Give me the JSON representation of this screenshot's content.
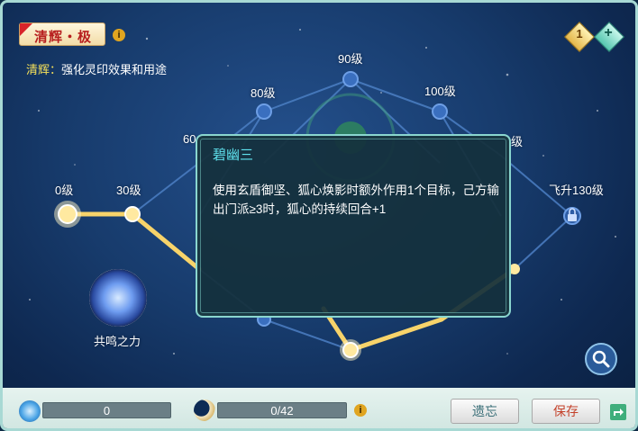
{
  "title_badge": "清辉・极",
  "description": {
    "highlight": "清辉：",
    "text": "强化灵印效果和用途"
  },
  "levels": {
    "l0": "0级",
    "l30": "30级",
    "l60": "60",
    "l80": "80级",
    "l90": "90级",
    "l100": "100级",
    "l110": "级",
    "l130": "飞升130级"
  },
  "tooltip": {
    "title": "碧幽三",
    "body": "使用玄盾御坚、狐心焕影时额外作用1个目标，己方输出门派≥3时，狐心的持续回合+1"
  },
  "resonance_label": "共鸣之力",
  "top_right": {
    "count": "1",
    "plus": "+"
  },
  "bottom": {
    "progress1": {
      "text": "0",
      "value": 0
    },
    "progress2": {
      "text": "0/42",
      "current": 0,
      "max": 42
    },
    "forget_label": "遗忘",
    "save_label": "保存"
  },
  "icons": {
    "info": "info-icon",
    "lock": "lock-icon",
    "search": "search-icon",
    "moon": "moon-icon",
    "swirl": "swirl-icon",
    "share": "share-icon"
  },
  "colors": {
    "gold_path": "#f7d36a",
    "tooltip_title": "#5fe2ee",
    "save_text": "#c4422b"
  }
}
